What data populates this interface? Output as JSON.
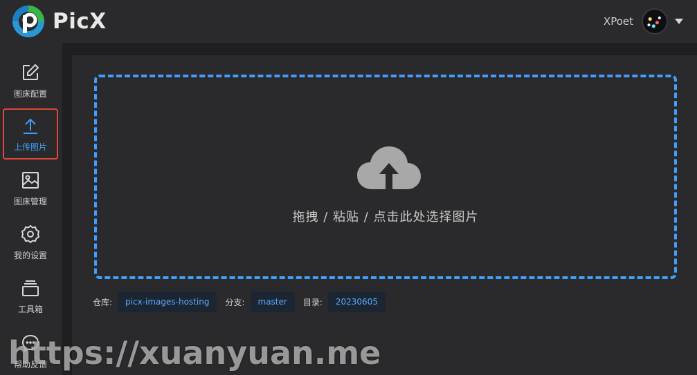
{
  "app": {
    "name": "PicX",
    "colors": {
      "accent": "#409eff",
      "active_border": "#e0463b",
      "background": "#1f1f21"
    }
  },
  "header": {
    "username": "XPoet",
    "icons": {
      "logo": "picx-logo-icon",
      "avatar": "user-avatar",
      "menu": "caret-down-icon"
    }
  },
  "sidebar": {
    "items": [
      {
        "label": "图床配置",
        "icon": "edit-icon",
        "active": false
      },
      {
        "label": "上传图片",
        "icon": "upload-icon",
        "active": true
      },
      {
        "label": "图床管理",
        "icon": "image-icon",
        "active": false
      },
      {
        "label": "我的设置",
        "icon": "gear-icon",
        "active": false
      },
      {
        "label": "工具箱",
        "icon": "toolbox-icon",
        "active": false
      },
      {
        "label": "帮助反馈",
        "icon": "chat-icon",
        "active": false
      }
    ]
  },
  "upload": {
    "dropzone_text": "拖拽 / 粘贴 / 点击此处选择图片",
    "icon": "cloud-upload-icon"
  },
  "info": {
    "repo_label": "仓库:",
    "repo_value": "picx-images-hosting",
    "branch_label": "分支:",
    "branch_value": "master",
    "dir_label": "目录:",
    "dir_value": "20230605"
  },
  "watermark": "https://xuanyuan.me"
}
